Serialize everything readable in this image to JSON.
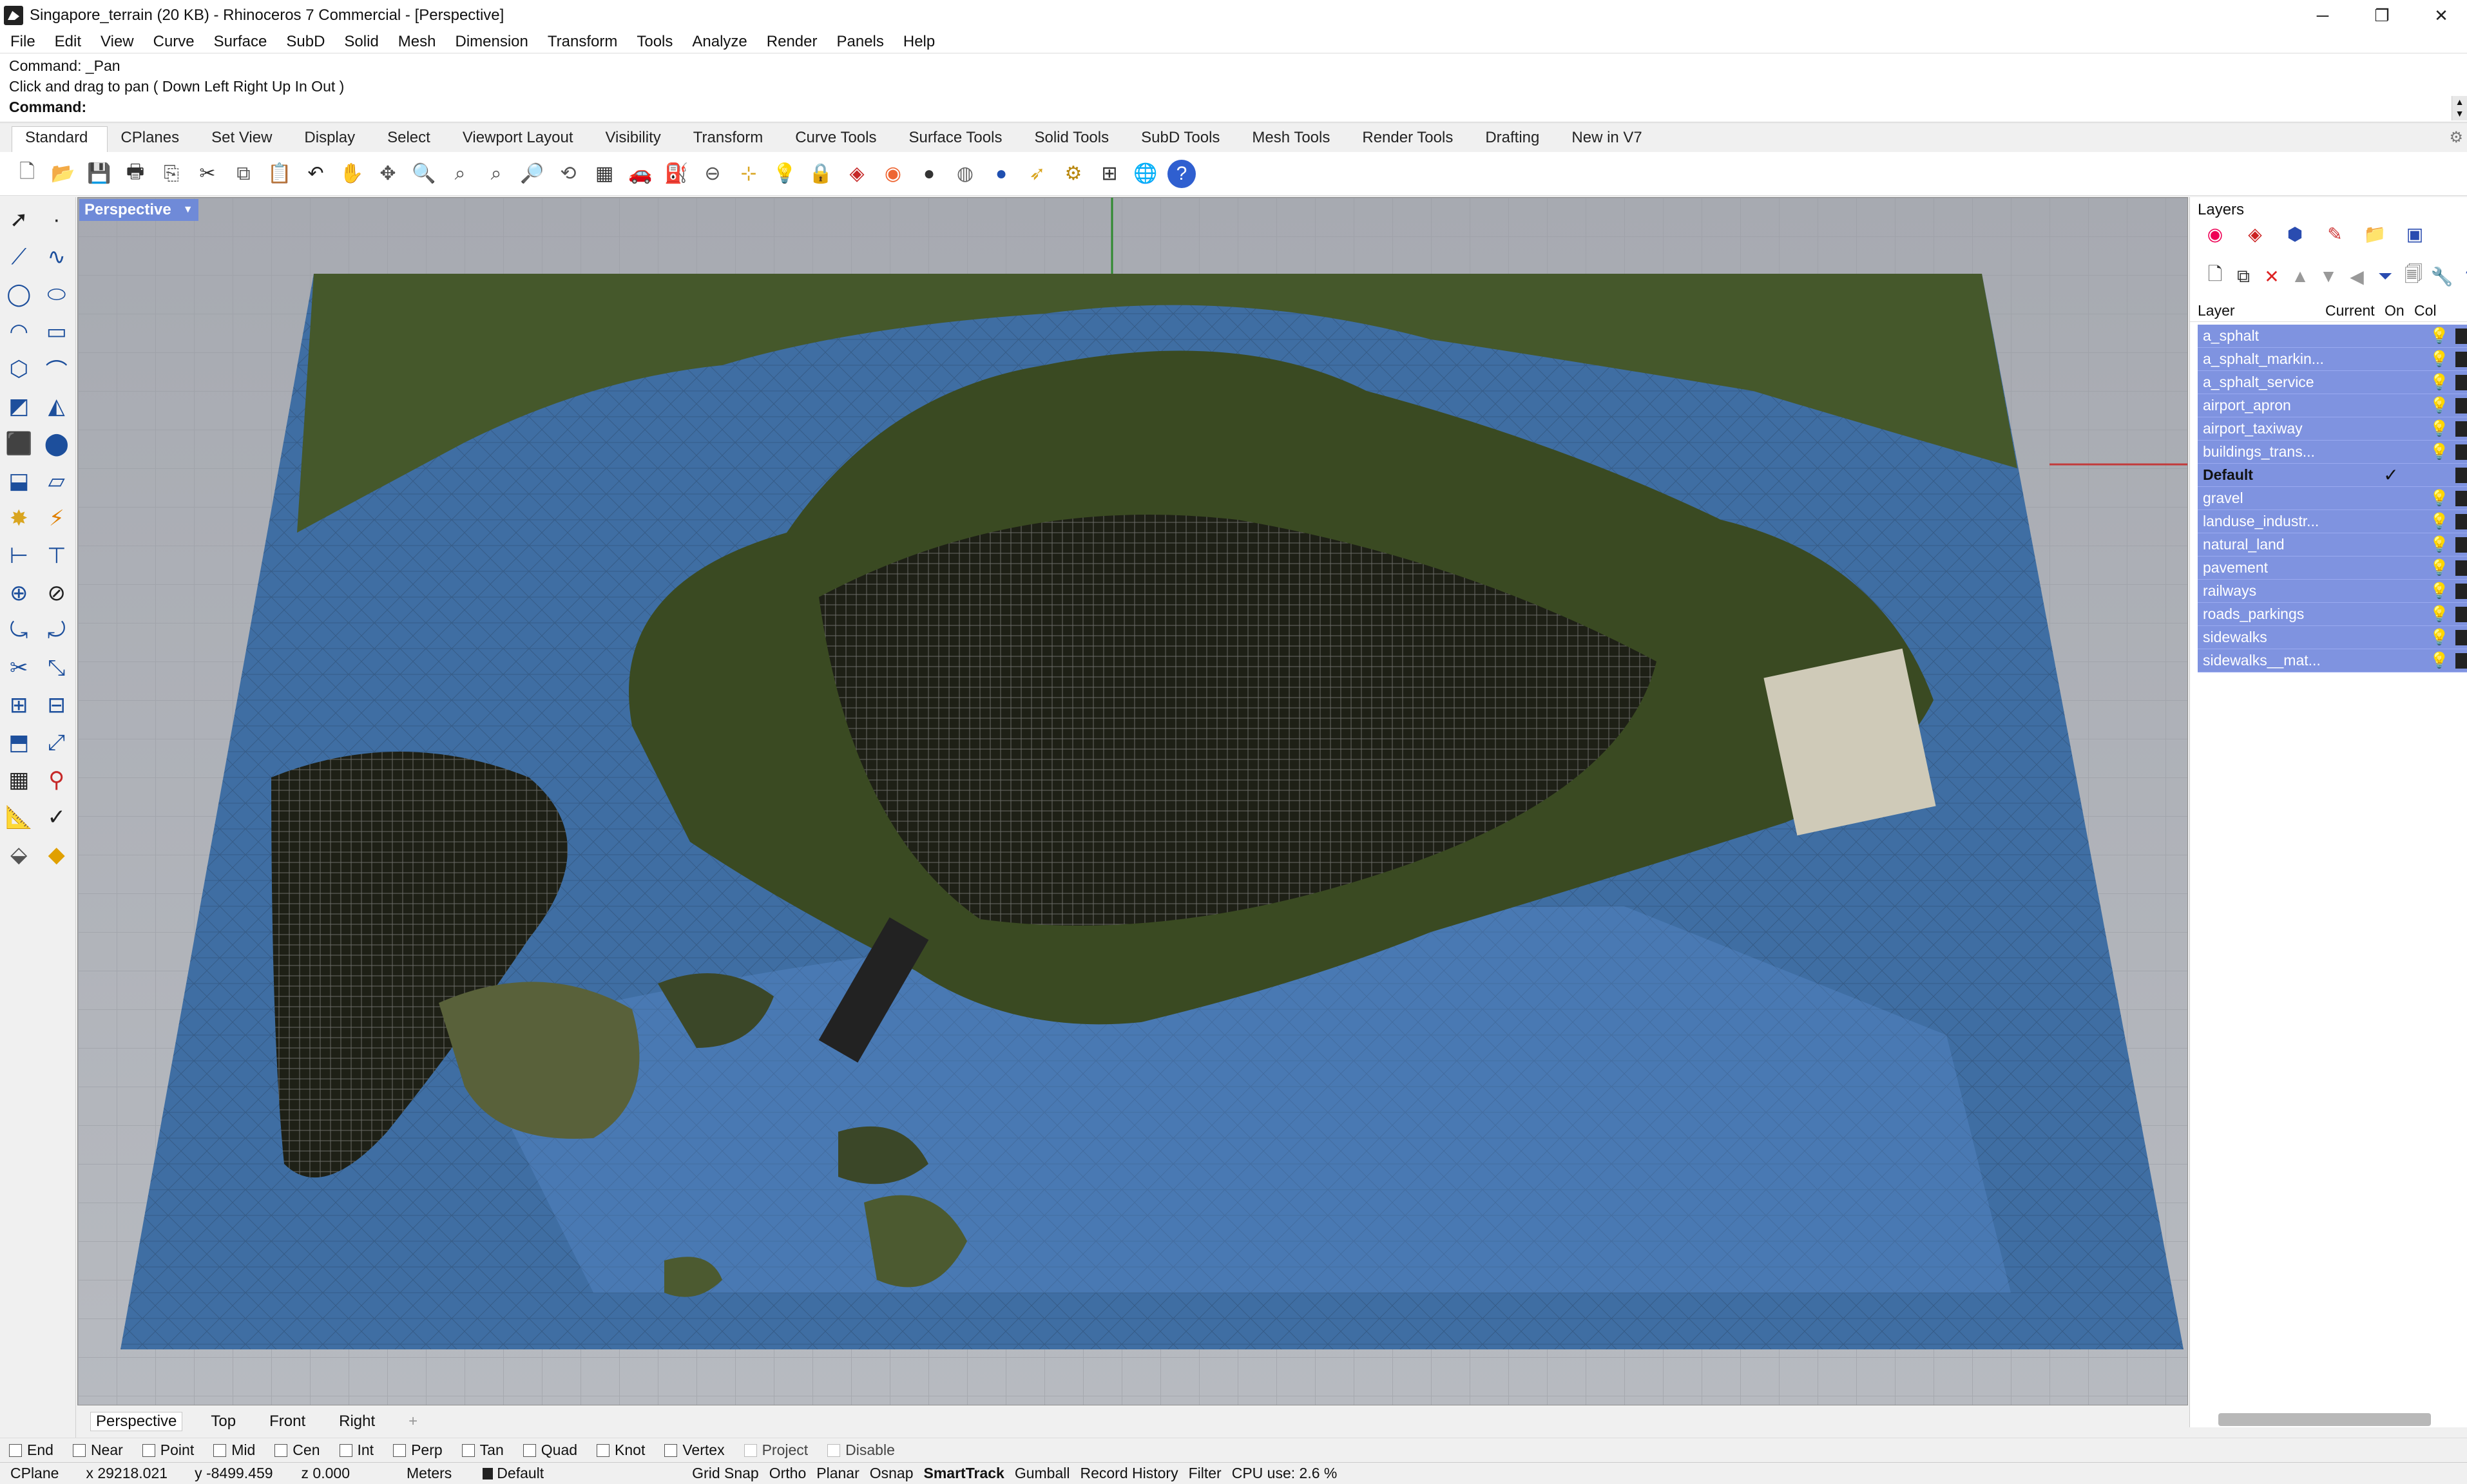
{
  "window": {
    "title": "Singapore_terrain (20 KB) - Rhinoceros 7 Commercial - [Perspective]",
    "minimize": "─",
    "maximize": "❐",
    "close": "✕"
  },
  "menu": [
    "File",
    "Edit",
    "View",
    "Curve",
    "Surface",
    "SubD",
    "Solid",
    "Mesh",
    "Dimension",
    "Transform",
    "Tools",
    "Analyze",
    "Render",
    "Panels",
    "Help"
  ],
  "command": {
    "history1": "Command: _Pan",
    "history2": "Click and drag to pan ( Down  Left  Right  Up  In  Out )",
    "prompt": "Command:",
    "value": ""
  },
  "toolbar_tabs": [
    "Standard",
    "CPlanes",
    "Set View",
    "Display",
    "Select",
    "Viewport Layout",
    "Visibility",
    "Transform",
    "Curve Tools",
    "Surface Tools",
    "Solid Tools",
    "SubD Tools",
    "Mesh Tools",
    "Render Tools",
    "Drafting",
    "New in V7"
  ],
  "toolbar_icons": [
    "new-file-icon",
    "open-folder-icon",
    "save-icon",
    "print-icon",
    "import-icon",
    "cut-icon",
    "copy-icon",
    "paste-icon",
    "undo-icon",
    "pan-hand-icon",
    "rotate-icon",
    "zoom-icon",
    "zoom-window-icon",
    "zoom-extents-icon",
    "zoom-selected-icon",
    "undo-view-icon",
    "grid-icon",
    "car-icon",
    "hide-icon",
    "lock-icon",
    "show-icon",
    "light-icon",
    "padlock-icon",
    "layer-icon",
    "color-wheel-icon",
    "shade-sphere-icon",
    "render-sphere-icon",
    "material-sphere-icon",
    "cursor-icon",
    "settings-gear-icon",
    "dimension-icon",
    "globe-icon",
    "help-icon"
  ],
  "viewport": {
    "label": "Perspective",
    "tabs": [
      "Perspective",
      "Top",
      "Front",
      "Right"
    ],
    "add_tab": "+"
  },
  "layers_panel": {
    "title": "Layers",
    "columns": {
      "layer": "Layer",
      "current": "Current",
      "on": "On",
      "color": "Col"
    },
    "layers": [
      {
        "name": "a_sphalt",
        "current": "",
        "bold": false
      },
      {
        "name": "a_sphalt_markin...",
        "current": "",
        "bold": false
      },
      {
        "name": "a_sphalt_service",
        "current": "",
        "bold": false
      },
      {
        "name": "airport_apron",
        "current": "",
        "bold": false
      },
      {
        "name": "airport_taxiway",
        "current": "",
        "bold": false
      },
      {
        "name": "buildings_trans...",
        "current": "",
        "bold": false
      },
      {
        "name": "Default",
        "current": "✓",
        "bold": true
      },
      {
        "name": "gravel",
        "current": "",
        "bold": false
      },
      {
        "name": "landuse_industr...",
        "current": "",
        "bold": false
      },
      {
        "name": "natural_land",
        "current": "",
        "bold": false
      },
      {
        "name": "pavement",
        "current": "",
        "bold": false
      },
      {
        "name": "railways",
        "current": "",
        "bold": false
      },
      {
        "name": "roads_parkings",
        "current": "",
        "bold": false
      },
      {
        "name": "sidewalks",
        "current": "",
        "bold": false
      },
      {
        "name": "sidewalks__mat...",
        "current": "",
        "bold": false
      }
    ]
  },
  "osnap": {
    "items": [
      "End",
      "Near",
      "Point",
      "Mid",
      "Cen",
      "Int",
      "Perp",
      "Tan",
      "Quad",
      "Knot",
      "Vertex",
      "Project",
      "Disable"
    ]
  },
  "status": {
    "cplane": "CPlane",
    "x": "x 29218.021",
    "y": "y -8499.459",
    "z": "z 0.000",
    "units": "Meters",
    "layer": "Default",
    "grid_snap": "Grid Snap",
    "ortho": "Ortho",
    "planar": "Planar",
    "osnap": "Osnap",
    "smarttrack": "SmartTrack",
    "gumball": "Gumball",
    "record_history": "Record History",
    "filter": "Filter",
    "cpu": "CPU use: 2.6 %"
  },
  "colors": {
    "layer_highlight": "#7f93e0",
    "viewport_bg": "#adb0b6",
    "sea": "#3f6ea3",
    "land": "#4b5a2a",
    "urban": "#2a2a2a"
  }
}
